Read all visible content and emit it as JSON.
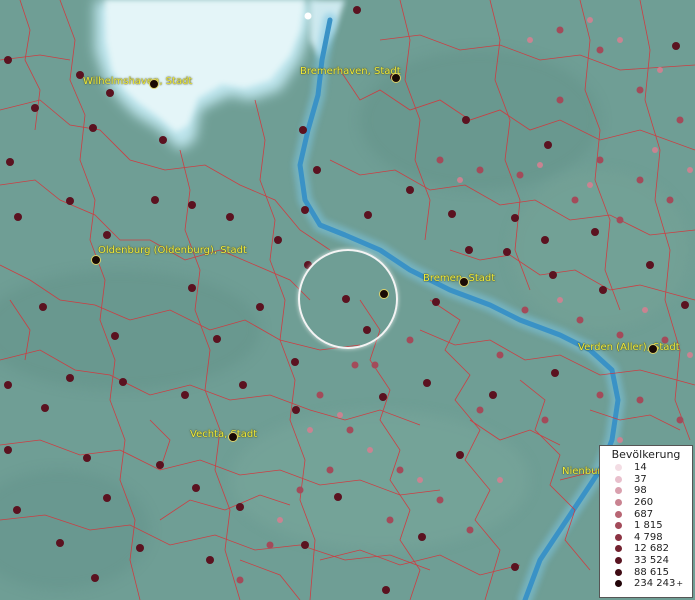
{
  "map": {
    "colors": {
      "land": "#6f9e95",
      "water": "#e4f5f8",
      "river": "#3a92c6",
      "boundary": "#d6343a",
      "label": "#f2ec3a"
    },
    "cities": [
      {
        "name": "Wilhelmshaven, Stadt"
      },
      {
        "name": "Bremerhaven, Stadt"
      },
      {
        "name": "Oldenburg (Oldenburg), Stadt"
      },
      {
        "name": "Bremen, Stadt"
      },
      {
        "name": "Verden (Aller), Stadt"
      },
      {
        "name": "Vechta, Stadt"
      },
      {
        "name": "Nienburg"
      }
    ]
  },
  "legend": {
    "title": "Bevölkerung",
    "items": [
      {
        "label": "14",
        "color": "#f3dde4"
      },
      {
        "label": "37",
        "color": "#e8bfcc"
      },
      {
        "label": "98",
        "color": "#d9a0ae"
      },
      {
        "label": "260",
        "color": "#c98391"
      },
      {
        "label": "687",
        "color": "#b86674"
      },
      {
        "label": "1 815",
        "color": "#a34b5a"
      },
      {
        "label": "4 798",
        "color": "#8c3343"
      },
      {
        "label": "12 682",
        "color": "#732230"
      },
      {
        "label": "33 524",
        "color": "#591421"
      },
      {
        "label": "88 615",
        "color": "#3f0b14"
      },
      {
        "label": "234 243",
        "color": "#220408",
        "suffix": "+"
      }
    ]
  }
}
